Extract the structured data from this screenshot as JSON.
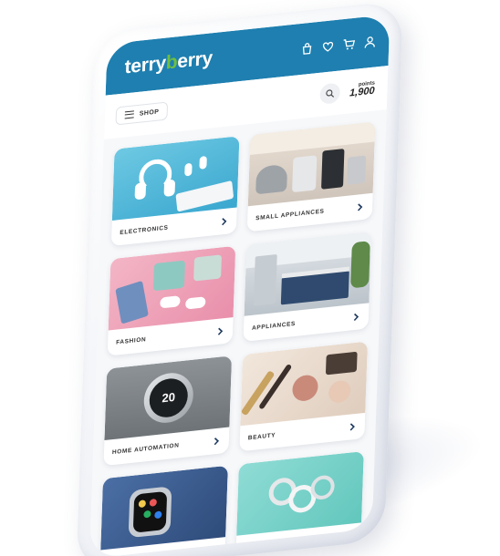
{
  "app": {
    "logo_left": "terry",
    "logo_accent": "b",
    "logo_right": "erry",
    "brand_color": "#1e7fb0",
    "accent_color": "#6fbf3f"
  },
  "header": {
    "icons": [
      "shopping-bag-icon",
      "heart-icon",
      "cart-icon",
      "user-icon"
    ]
  },
  "subbar": {
    "shop_label": "SHOP",
    "points_label": "points",
    "points_value": "1,900"
  },
  "categories": [
    {
      "label": "ELECTRONICS",
      "image": "headphones-keyboard-image"
    },
    {
      "label": "SMALL APPLIANCES",
      "image": "kitchen-appliances-image"
    },
    {
      "label": "FASHION",
      "image": "clothing-image"
    },
    {
      "label": "APPLIANCES",
      "image": "kitchen-image"
    },
    {
      "label": "HOME AUTOMATION",
      "image": "thermostat-image",
      "thermostat_temp": "20"
    },
    {
      "label": "BEAUTY",
      "image": "cosmetics-image"
    },
    {
      "label": "",
      "image": "smartwatch-image"
    },
    {
      "label": "",
      "image": "jewelry-image"
    }
  ]
}
